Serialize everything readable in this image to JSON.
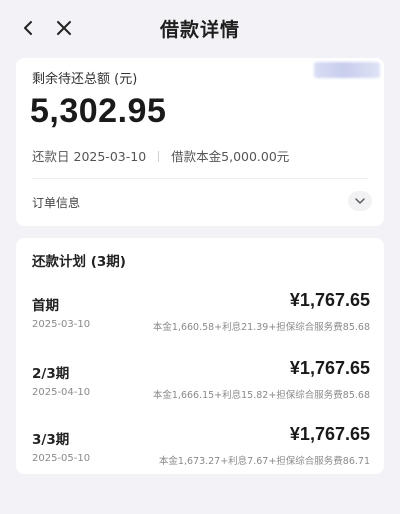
{
  "nav": {
    "title": "借款详情",
    "back_icon": "chevron-left-icon",
    "close_icon": "close-icon"
  },
  "summary": {
    "remaining_label": "剩余待还总额 (元)",
    "remaining_amount": "5,302.95",
    "repay_day_label": "还款日",
    "repay_day": "2025-03-10",
    "principal_label": "借款本金",
    "principal": "5,000.00元",
    "order_info_label": "订单信息"
  },
  "plan": {
    "title": "还款计划 (3期)",
    "periods": [
      {
        "name": "首期",
        "amount": "¥1,767.65",
        "date": "2025-03-10",
        "detail": "本金1,660.58+利息21.39+担保综合服务费85.68"
      },
      {
        "name": "2/3期",
        "amount": "¥1,767.65",
        "date": "2025-04-10",
        "detail": "本金1,666.15+利息15.82+担保综合服务费85.68"
      },
      {
        "name": "3/3期",
        "amount": "¥1,767.65",
        "date": "2025-05-10",
        "detail": "本金1,673.27+利息7.67+担保综合服务费86.71"
      }
    ]
  },
  "colors": {
    "background": "#f3f3f7",
    "card": "#ffffff",
    "primary_text": "#1a1a1a",
    "secondary_text": "#8a8a8a"
  }
}
